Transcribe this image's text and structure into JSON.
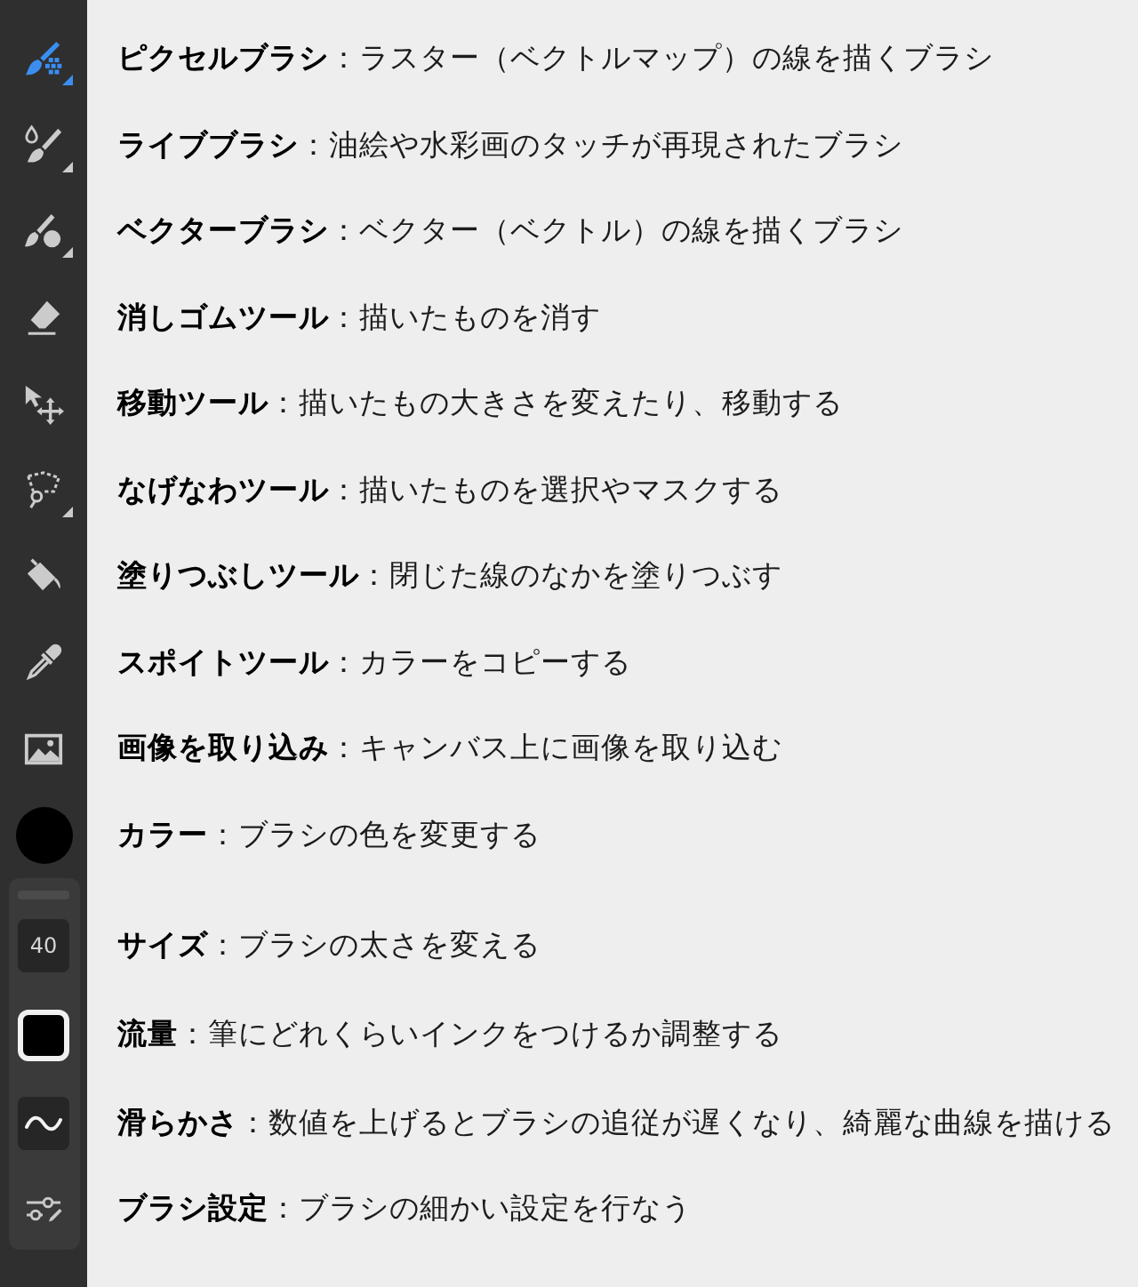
{
  "toolbar": {
    "tools": [
      {
        "kind": "pixel_brush",
        "selected": true,
        "submenu": true
      },
      {
        "kind": "live_brush",
        "selected": false,
        "submenu": true
      },
      {
        "kind": "vector_brush",
        "selected": false,
        "submenu": true
      },
      {
        "kind": "eraser",
        "selected": false,
        "submenu": false
      },
      {
        "kind": "move",
        "selected": false,
        "submenu": false
      },
      {
        "kind": "lasso",
        "selected": false,
        "submenu": true
      },
      {
        "kind": "fill",
        "selected": false,
        "submenu": false
      },
      {
        "kind": "eyedropper",
        "selected": false,
        "submenu": false
      },
      {
        "kind": "image",
        "selected": false,
        "submenu": false
      }
    ],
    "color": "#000000"
  },
  "brush_panel": {
    "size": "40",
    "flow_swatch": {
      "color": "#000000"
    }
  },
  "tool_descriptions": [
    "**ピクセルブラシ**：ラスター（ベクトルマップ）の線を描くブラシ",
    "**ライブブラシ**：油絵や水彩画のタッチが再現されたブラシ",
    "**ベクターブラシ**：ベクター（ベクトル）の線を描くブラシ",
    "**消しゴムツール**：描いたものを消す",
    "**移動ツール**：描いたもの大きさを変えたり、移動する",
    "**なげなわツール**：描いたものを選択やマスクする",
    "**塗りつぶしツール**：閉じた線のなかを塗りつぶす",
    "**スポイトツール**：カラーをコピーする",
    "**画像を取り込み**：キャンバス上に画像を取り込む",
    "**カラー**：ブラシの色を変更する"
  ],
  "panel_descriptions": [
    "**サイズ**：ブラシの太さを変える",
    "**流量**：筆にどれくらいインクをつけるか調整する",
    "**滑らかさ**：数値を上げるとブラシの追従が遅くなり、綺麗な曲線を描ける",
    "**ブラシ設定**：ブラシの細かい設定を行なう"
  ]
}
